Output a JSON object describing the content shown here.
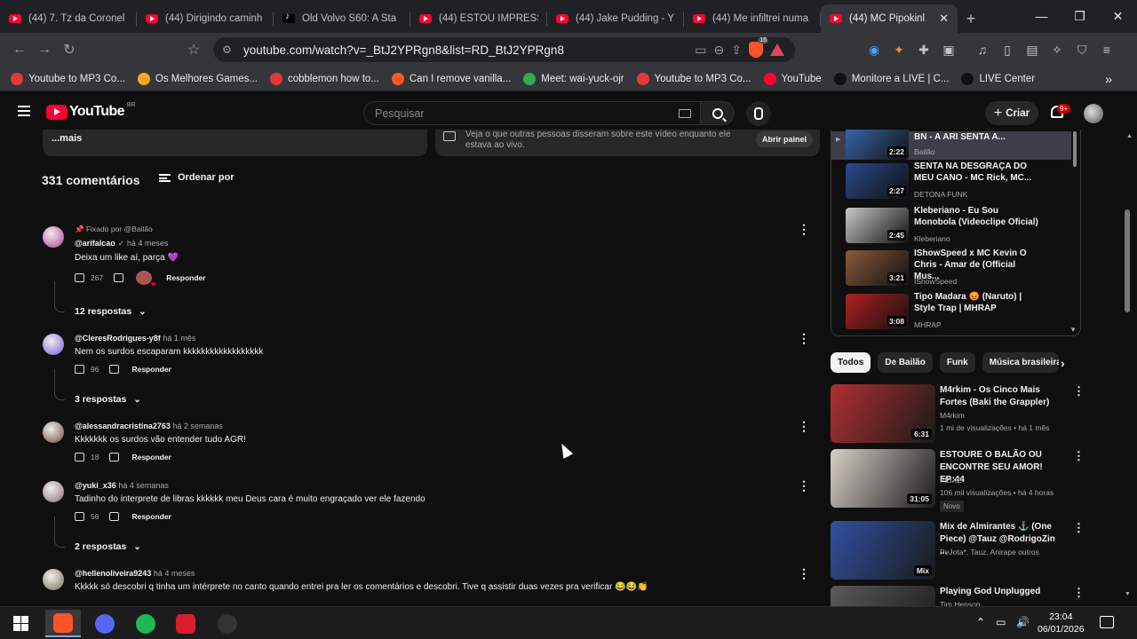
{
  "browser": {
    "tabs": [
      {
        "title": "(44) 7. Tz da Coronel",
        "icon": "youtube-icon",
        "active": false
      },
      {
        "title": "(44) Dirigindo caminh",
        "icon": "youtube-icon",
        "active": false
      },
      {
        "title": "Old Volvo S60: A Sta",
        "icon": "tiktok-icon",
        "active": false
      },
      {
        "title": "(44) ESTOU IMPRESSI",
        "icon": "youtube-icon",
        "active": false
      },
      {
        "title": "(44) Jake Pudding - Y",
        "icon": "youtube-icon",
        "active": false
      },
      {
        "title": "(44) Me infiltrei numa",
        "icon": "youtube-icon",
        "active": false
      },
      {
        "title": "(44) MC Pipokinl",
        "icon": "youtube-icon",
        "active": true
      }
    ],
    "url": "youtube.com/watch?v=_BtJ2YPRgn8&list=RD_BtJ2YPRgn8",
    "brave_badge": "16",
    "bookmarks": [
      {
        "label": "Youtube to MP3 Co...",
        "color": "#e53935"
      },
      {
        "label": "Os Melhores Games...",
        "color": "#f9a825"
      },
      {
        "label": "cobblemon how to...",
        "color": "#e53935"
      },
      {
        "label": "Can I remove vanilla...",
        "color": "#ff5722"
      },
      {
        "label": "Meet: wai-yuck-ojr",
        "color": "#34a853"
      },
      {
        "label": "Youtube to MP3 Co...",
        "color": "#e53935"
      },
      {
        "label": "YouTube",
        "color": "#ff0033"
      },
      {
        "label": "Monitore a LIVE | C...",
        "color": "#111111"
      },
      {
        "label": "LIVE Center",
        "color": "#111111"
      }
    ]
  },
  "youtube": {
    "logo_text": "YouTube",
    "logo_region": "BR",
    "search_placeholder": "Pesquisar",
    "create_label": "Criar",
    "notif_badge": "9+",
    "description_more": "...mais",
    "chat_text": "Veja o que outras pessoas disseram sobre este vídeo enquanto ele estava ao vivo.",
    "chat_button": "Abrir painel",
    "comment_count": "331 comentários",
    "sort_label": "Ordenar por",
    "reply_label": "Responder",
    "comments": [
      {
        "pinned": "Fixado por @Bailão",
        "author": "@arifalcao",
        "verified": "✓",
        "time": "há 4 meses",
        "text": "Deixa um like aí, parça 💜",
        "likes": "267",
        "replies": "12 respostas",
        "avatar_color": "#b04090"
      },
      {
        "pinned": "",
        "author": "@CleresRodrigues-y8f",
        "verified": "",
        "time": "há 1 mês",
        "text": "Nem os surdos escaparam kkkkkkkkkkkkkkkkkk",
        "likes": "96",
        "replies": "3 respostas",
        "avatar_color": "#7a5cd6"
      },
      {
        "pinned": "",
        "author": "@alessandracristina2763",
        "verified": "",
        "time": "há 2 semanas",
        "text": "Kkkkkkk os surdos vão entender tudo AGR!",
        "likes": "18",
        "replies": "",
        "avatar_color": "#6b4a3a"
      },
      {
        "pinned": "",
        "author": "@yuki_x36",
        "verified": "",
        "time": "há 4 semanas",
        "text": "Tadinho do interprete de libras kkkkkk meu Deus cara é muito engraçado ver ele fazendo",
        "likes": "56",
        "replies": "2 respostas",
        "avatar_color": "#8a6a7a"
      },
      {
        "pinned": "",
        "author": "@hellenoliveira9243",
        "verified": "",
        "time": "há 4 meses",
        "text": "Kkkkk só descobri q tinha um intérprete no canto quando entrei pra ler os comentários e descobri. Tive q assistir duas vezes pra verificar 😂😂👏",
        "likes": "",
        "replies": "",
        "avatar_color": "#7a6a5a"
      }
    ],
    "playlist": [
      {
        "title": "BN - A ARI SENTA A...",
        "channel": "Bailão",
        "duration": "2:22",
        "current": true,
        "thumb": "#3a6ab0"
      },
      {
        "title": "SENTA NA DESGRAÇA DO MEU CANO - MC Rick, MC...",
        "channel": "DETONA FUNK",
        "duration": "2:27",
        "current": false,
        "thumb": "#2a4a8a"
      },
      {
        "title": "Kleberiano - Eu Sou Monobola (Videoclipe Oficial)",
        "channel": "Kleberiano",
        "duration": "2:45",
        "current": false,
        "thumb": "#c8c8c8"
      },
      {
        "title": "IShowSpeed x MC Kevin O Chris - Amar de (Official Mus...",
        "channel": "IShowSpeed",
        "duration": "3:21",
        "current": false,
        "thumb": "#8a5a3a"
      },
      {
        "title": "Tipo Madara 😡 (Naruto) | Style Trap | MHRAP",
        "channel": "MHRAP",
        "duration": "3:08",
        "current": false,
        "thumb": "#b02020"
      }
    ],
    "chips": [
      {
        "label": "Todos",
        "active": true
      },
      {
        "label": "De Bailão",
        "active": false
      },
      {
        "label": "Funk",
        "active": false
      },
      {
        "label": "Música brasileira",
        "active": false
      }
    ],
    "recommendations": [
      {
        "title": "M4rkim - Os Cinco Mais Fortes (Baki the Grappler)",
        "channel": "M4rkim",
        "meta": "1 mi de visualizações • há 1 mês",
        "duration": "6:31",
        "badge": "",
        "thumb": "#b03030"
      },
      {
        "title": "ESTOURE O BALÃO OU ENCONTRE SEU AMOR! EP:44",
        "channel": "PEIXE",
        "meta": "106 mil visualizações • há 4 horas",
        "duration": "31:05",
        "badge": "Novo",
        "thumb": "#d8d0c8"
      },
      {
        "title": "Mix de Almirantes ⚓ (One Piece) @Tauz @RodrigoZin ...",
        "channel": "PeJota*, Tauz, Anirape outros",
        "meta": "",
        "duration": "Mix",
        "badge": "",
        "thumb": "#3050a0"
      },
      {
        "title": "Playing God Unplugged",
        "channel": "Tim Henson",
        "meta": "",
        "duration": "",
        "badge": "",
        "thumb": "#5a5a5a"
      }
    ]
  },
  "taskbar": {
    "time": "23:04",
    "date": "06/01/2026",
    "apps": [
      {
        "name": "brave",
        "color": "#fb542b",
        "active": true
      },
      {
        "name": "discord",
        "color": "#5865f2",
        "active": false
      },
      {
        "name": "spotify",
        "color": "#1db954",
        "active": false
      },
      {
        "name": "tf",
        "color": "#d81e2a",
        "active": false
      },
      {
        "name": "obs",
        "color": "#333333",
        "active": false
      }
    ]
  }
}
